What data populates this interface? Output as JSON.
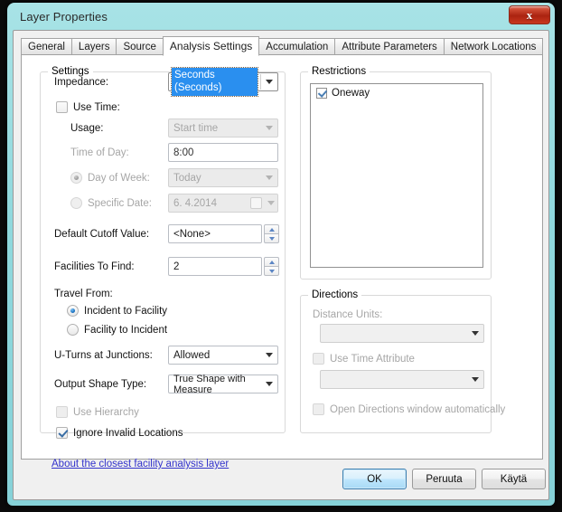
{
  "window": {
    "title": "Layer Properties",
    "close_icon": "close-icon",
    "close_label": "x"
  },
  "tabs": [
    {
      "label": "General",
      "active": false
    },
    {
      "label": "Layers",
      "active": false
    },
    {
      "label": "Source",
      "active": false
    },
    {
      "label": "Analysis Settings",
      "active": true
    },
    {
      "label": "Accumulation",
      "active": false
    },
    {
      "label": "Attribute Parameters",
      "active": false
    },
    {
      "label": "Network Locations",
      "active": false
    }
  ],
  "settings": {
    "legend": "Settings",
    "impedance_label": "Impedance:",
    "impedance_value": "Seconds (Seconds)",
    "use_time_label": "Use Time:",
    "use_time_checked": false,
    "usage_label": "Usage:",
    "usage_value": "Start time",
    "time_of_day_label": "Time of Day:",
    "time_of_day_value": "8:00",
    "day_of_week_label": "Day of Week:",
    "day_of_week_value": "Today",
    "specific_date_label": "Specific Date:",
    "specific_date_value": "6.  4.2014",
    "default_cutoff_label": "Default Cutoff Value:",
    "default_cutoff_value": "<None>",
    "facilities_label": "Facilities To Find:",
    "facilities_value": "2",
    "travel_from_label": "Travel From:",
    "incident_to_facility_label": "Incident to Facility",
    "facility_to_incident_label": "Facility to Incident",
    "uturns_label": "U-Turns at Junctions:",
    "uturns_value": "Allowed",
    "output_shape_label": "Output Shape Type:",
    "output_shape_value": "True Shape with Measure",
    "use_hierarchy_label": "Use Hierarchy",
    "ignore_invalid_label": "Ignore Invalid Locations"
  },
  "restrictions": {
    "legend": "Restrictions",
    "items": [
      {
        "label": "Oneway",
        "checked": true
      }
    ]
  },
  "directions": {
    "legend": "Directions",
    "distance_units_label": "Distance Units:",
    "distance_units_value": "",
    "use_time_attribute_label": "Use Time Attribute",
    "time_attribute_value": "",
    "open_directions_label": "Open Directions window automatically"
  },
  "about_link": "About the closest facility analysis layer",
  "buttons": {
    "ok": "OK",
    "cancel": "Peruuta",
    "apply": "Käytä"
  }
}
